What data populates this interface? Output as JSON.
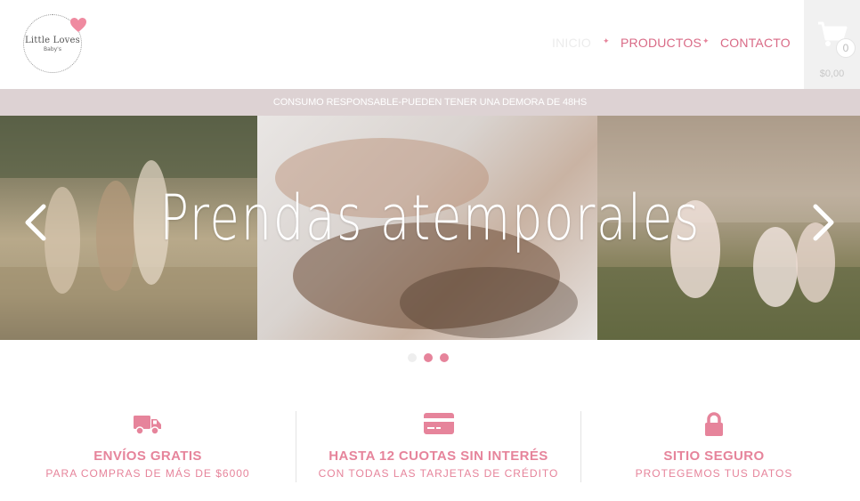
{
  "header": {
    "logo": {
      "title": "Little Loves",
      "subtitle": "Baby's"
    },
    "nav": [
      {
        "label": "INICIO"
      },
      {
        "label": "PRODUCTOS"
      },
      {
        "label": "CONTACTO"
      }
    ],
    "separator": "✦",
    "cart": {
      "count": "0",
      "total": "$0,00"
    }
  },
  "announcement": "CONSUMO RESPONSABLE-PUEDEN TENER UNA DEMORA DE 48HS",
  "slider": {
    "title": "Prendas atemporales",
    "dots": 3,
    "active_dot": 0
  },
  "features": [
    {
      "icon": "truck-icon",
      "title": "ENVÍOS GRATIS",
      "subtitle": "PARA COMPRAS DE MÁS DE $6000"
    },
    {
      "icon": "credit-card-icon",
      "title": "HASTA 12 CUOTAS SIN INTERÉS",
      "subtitle": "CON TODAS LAS TARJETAS DE CRÉDITO"
    },
    {
      "icon": "lock-icon",
      "title": "SITIO SEGURO",
      "subtitle": "PROTEGEMOS TUS DATOS"
    }
  ],
  "colors": {
    "accent": "#e6849b",
    "nav_active": "#ececec",
    "announcement_bg": "#ddd2d3",
    "cart_bg": "#f1f1f1"
  }
}
